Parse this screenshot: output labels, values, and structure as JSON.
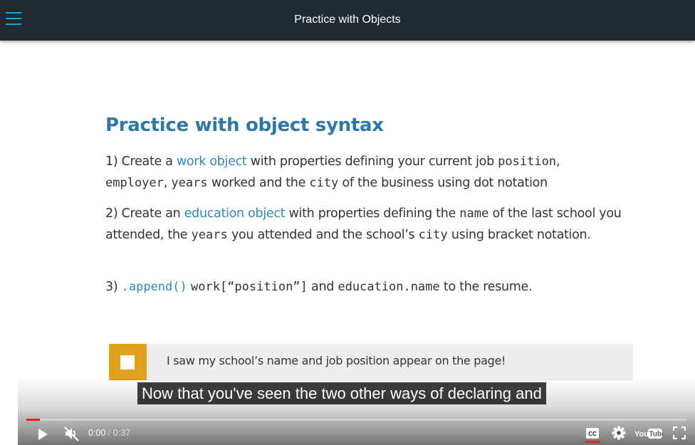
{
  "header": {
    "title": "Practice with Objects",
    "menu_icon": "hamburger-menu-icon"
  },
  "slide": {
    "heading": "Practice with object syntax",
    "item1": {
      "prefix": "1) Create a ",
      "kw": "work object",
      "mid1": " with properties defining your current job ",
      "c1": "position",
      "mid2": ",",
      "c2": "employer",
      "mid3": ", ",
      "c3": "years",
      "mid4": " worked and the ",
      "c4": "city",
      "suffix": " of the business using dot notation"
    },
    "item2": {
      "prefix": "2) Create an ",
      "kw": "education object",
      "mid1": " with properties defining the ",
      "c1": "name",
      "mid2": " of the last school you attended, the ",
      "c2": "years",
      "mid3": " you attended and the school’s ",
      "c3": "city",
      "suffix": " using bracket notation."
    },
    "item3": {
      "prefix": "3) ",
      "c1": ".append()",
      "c2": "work[“position”]",
      "mid": " and ",
      "c3": "education.name",
      "suffix": " to the resume."
    },
    "checkbox_label": "I saw my school’s name and job position appear on the page!"
  },
  "player": {
    "caption": "Now that you've seen the two other ways of declaring and",
    "time_current": "0:00",
    "time_sep": " / ",
    "time_total": "0:37",
    "progress_fraction": 0.02,
    "accent_color": "#e62117"
  }
}
